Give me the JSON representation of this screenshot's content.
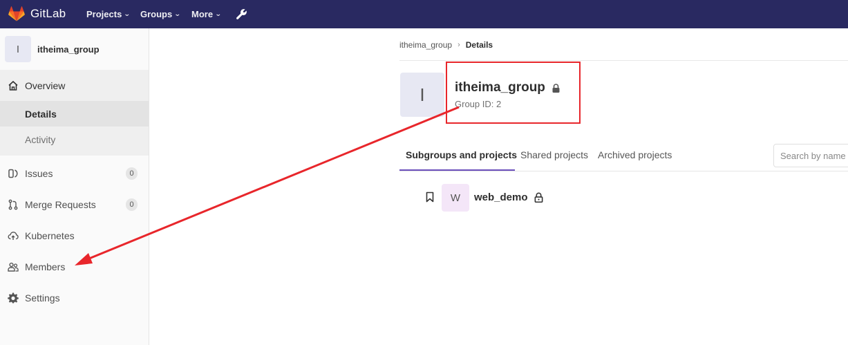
{
  "navbar": {
    "logo_text": "GitLab",
    "items": [
      {
        "label": "Projects"
      },
      {
        "label": "Groups"
      },
      {
        "label": "More"
      }
    ],
    "bg_color": "#292961"
  },
  "sidebar": {
    "context": {
      "avatar_letter": "I",
      "name": "itheima_group"
    },
    "overview": {
      "label": "Overview"
    },
    "sub_items": [
      {
        "label": "Details"
      },
      {
        "label": "Activity"
      }
    ],
    "items": [
      {
        "label": "Issues",
        "count": "0"
      },
      {
        "label": "Merge Requests",
        "count": "0"
      },
      {
        "label": "Kubernetes"
      },
      {
        "label": "Members"
      },
      {
        "label": "Settings"
      }
    ]
  },
  "breadcrumb": {
    "parent": "itheima_group",
    "separator": "›",
    "current": "Details"
  },
  "group": {
    "avatar_letter": "I",
    "name": "itheima_group",
    "id_text": "Group ID: 2"
  },
  "tabs": [
    {
      "label": "Subgroups and projects",
      "active": true
    },
    {
      "label": "Shared projects"
    },
    {
      "label": "Archived projects"
    }
  ],
  "search": {
    "placeholder": "Search by name"
  },
  "projects": [
    {
      "avatar_letter": "W",
      "name": "web_demo"
    }
  ],
  "colors": {
    "accent": "#6b4fbb",
    "annotation": "#e8262b"
  }
}
